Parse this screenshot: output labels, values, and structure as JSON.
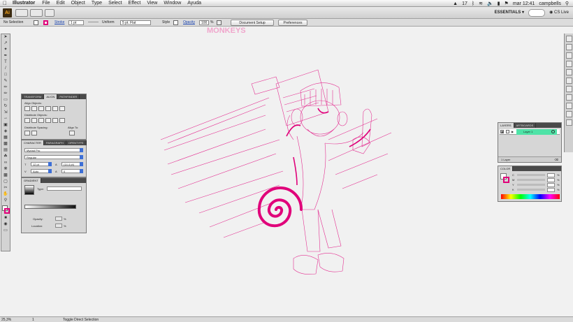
{
  "menubar": {
    "app_name": "Illustrator",
    "menus": [
      "File",
      "Edit",
      "Object",
      "Type",
      "Select",
      "Effect",
      "View",
      "Window",
      "Ayuda"
    ],
    "status_right": {
      "adobe_count": "17",
      "clock": "mar 12:41",
      "user": "campbells"
    }
  },
  "appbar": {
    "logo": "Ai",
    "workspace": "ESSENTIALS",
    "cs_live": "CS Live"
  },
  "control_bar": {
    "selection": "No Selection",
    "stroke_label": "Stroke",
    "stroke_weight": "1 pt",
    "stroke_profile": "Uniform",
    "brush": "5 pt. Flat",
    "style_label": "Style",
    "opacity_label": "Opacity",
    "opacity_value": "100",
    "opacity_unit": "%",
    "document_setup": "Document Setup",
    "preferences": "Preferences",
    "fill_color": "#ffffff",
    "stroke_color": "#e0007a"
  },
  "artwork": {
    "header_text": "MONKEYS",
    "stroke_color": "#e0007a"
  },
  "align_panel": {
    "tabs": [
      "TRANSFORM",
      "ALIGN",
      "PATHFINDER"
    ],
    "align_objects": "Align Objects:",
    "distribute_objects": "Distribute Objects:",
    "distribute_spacing": "Distribute Spacing:",
    "align_to": "Align To:"
  },
  "character_panel": {
    "tabs": [
      "CHARACTER",
      "PARAGRAPH",
      "OPENTYPE"
    ],
    "font_family": "Myriad Pro",
    "font_style": "Regular",
    "font_size": "12 pt",
    "leading": "(14,4 pt)",
    "kerning": "Auto",
    "tracking": "0"
  },
  "gradient_panel": {
    "title": "GRADIENT",
    "type_label": "Type:",
    "opacity_label": "Opacity:",
    "location_label": "Location:",
    "percent": "%"
  },
  "layers_panel": {
    "tabs": [
      "LAYERS",
      "ARTBOARDS"
    ],
    "layer_name": "Layer 1",
    "footer": "1 Layer",
    "layer_color": "#4fe3a7"
  },
  "color_panel": {
    "title": "COLOR",
    "channels": [
      "C",
      "M",
      "Y",
      "K"
    ],
    "percent": "%"
  },
  "status_bar": {
    "zoom": "25,3%",
    "page": "1",
    "tool": "Toggle Direct Selection"
  }
}
